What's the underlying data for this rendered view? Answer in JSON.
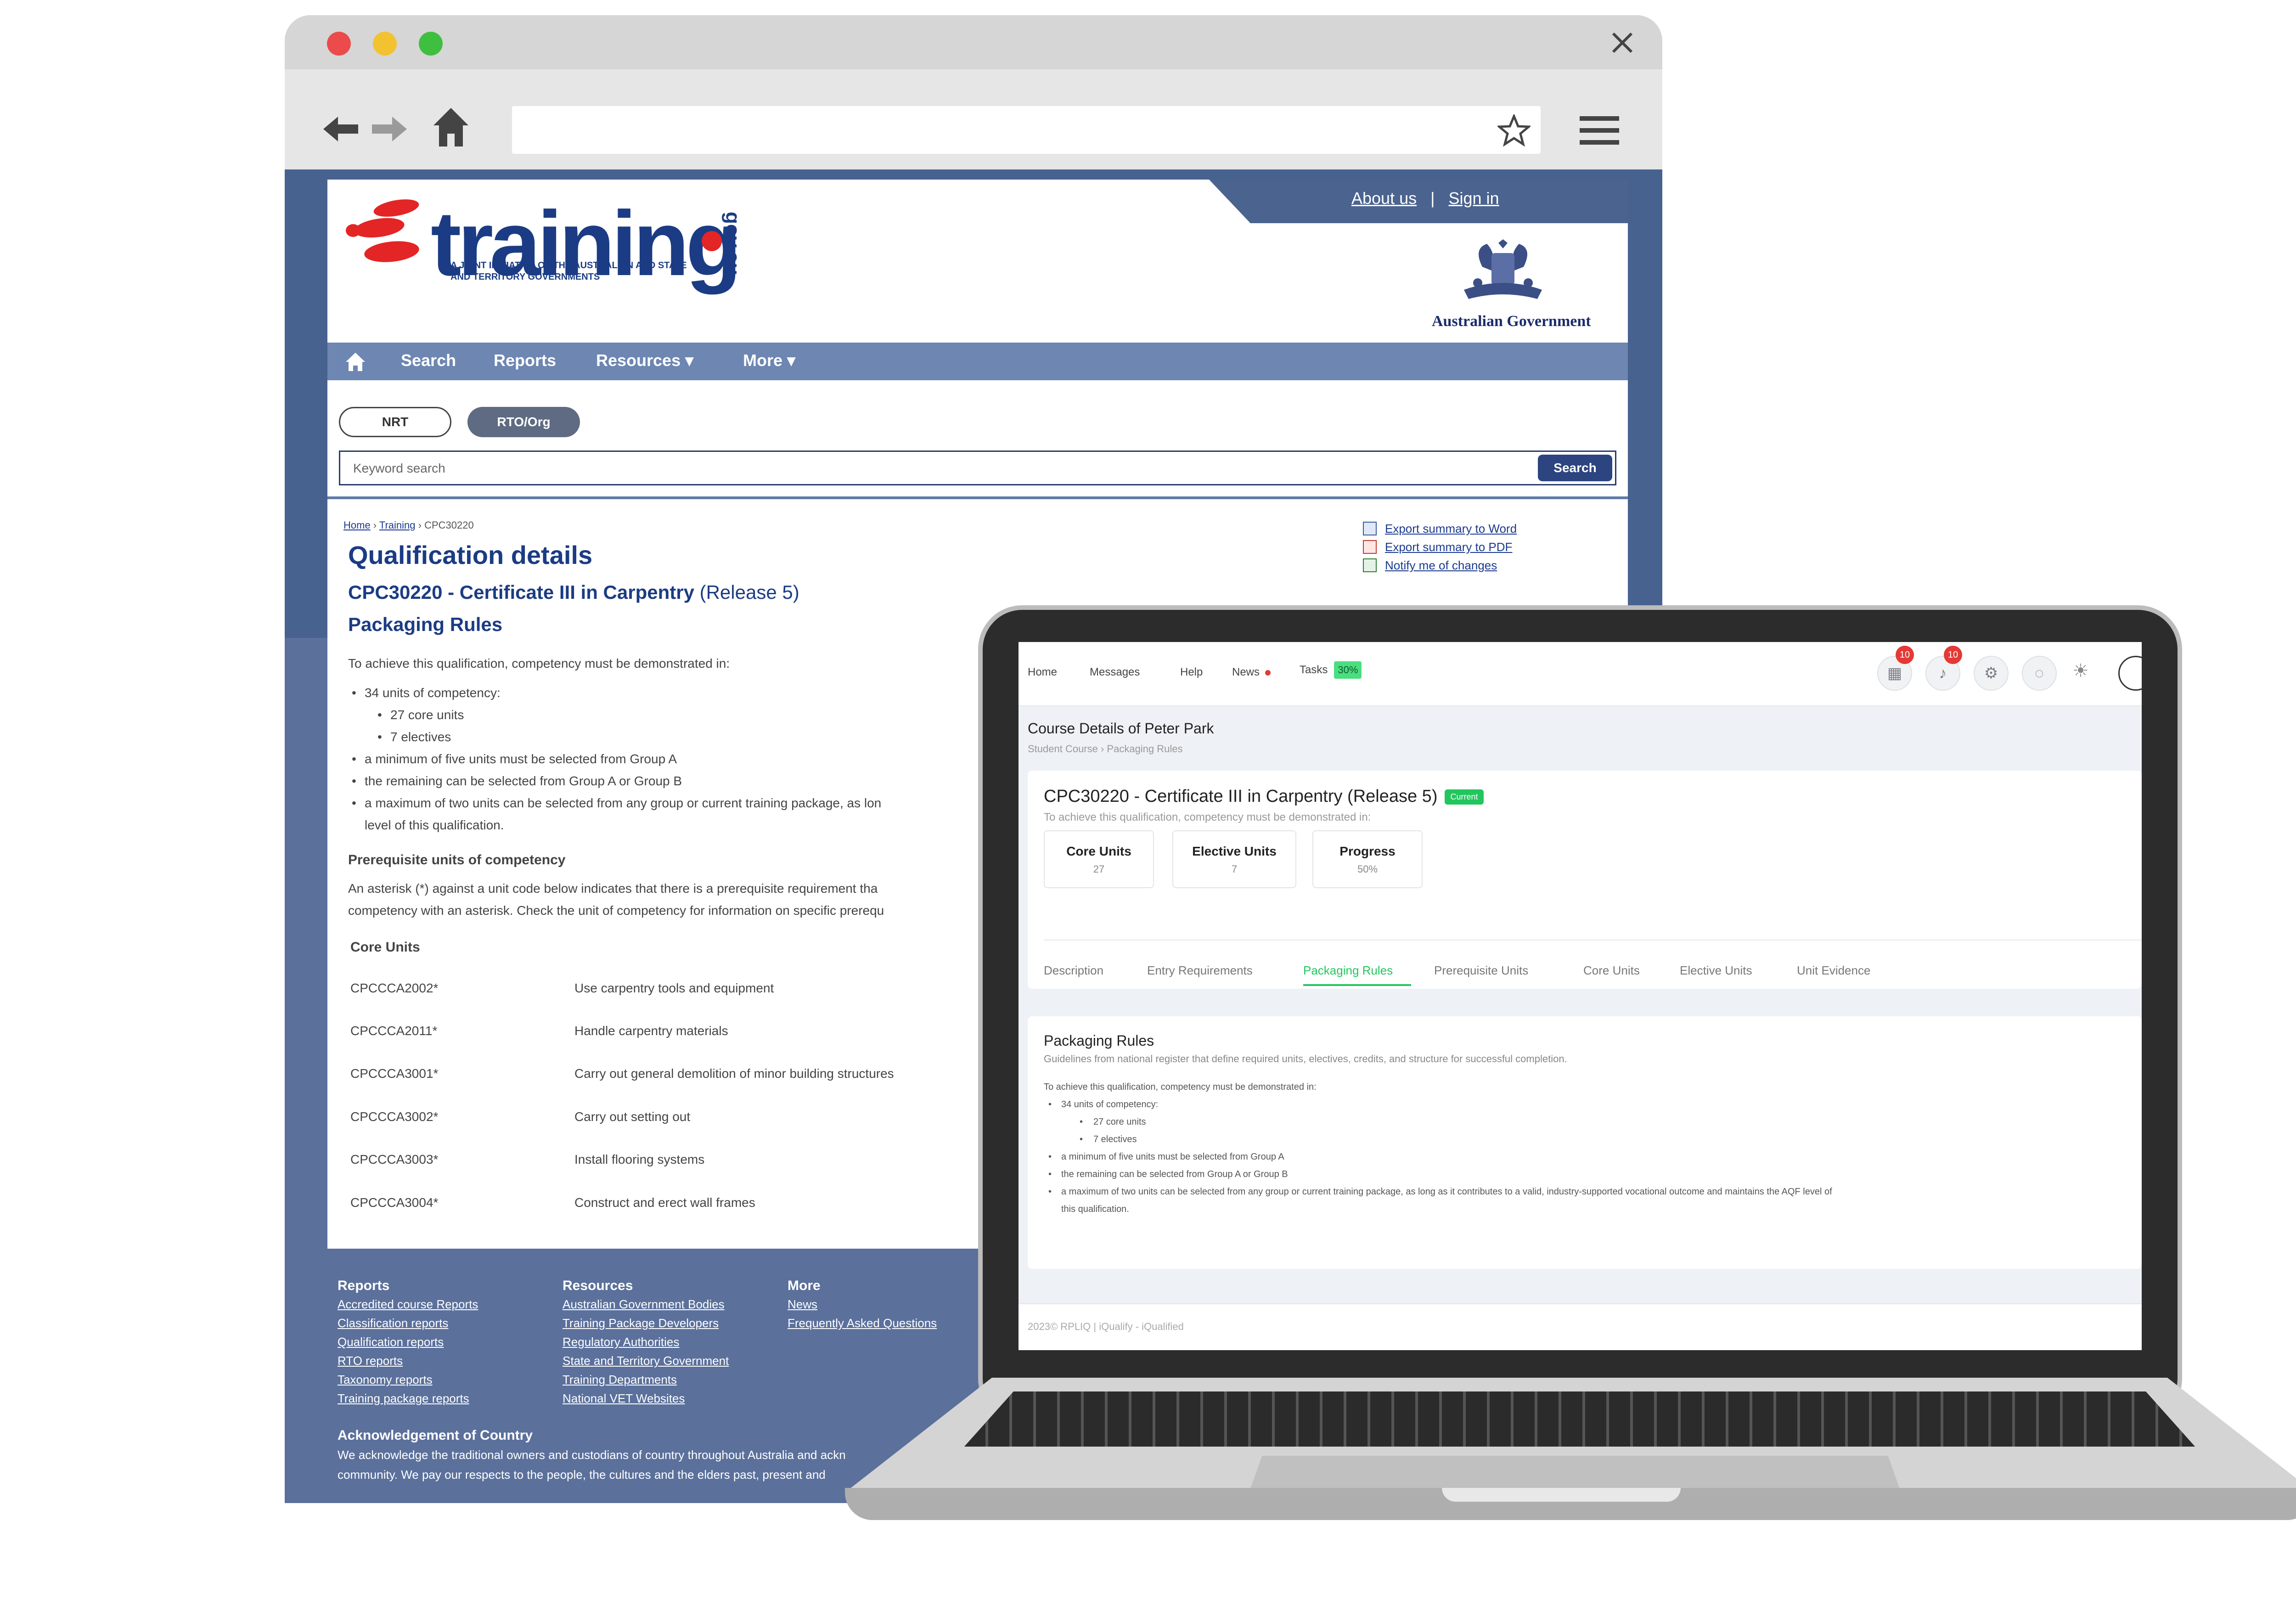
{
  "colors": {
    "brand_navy": "#1b3c84",
    "brand_red": "#e32526",
    "nav_blue": "#6d86b2",
    "footer_blue": "#5b709b",
    "accent_green": "#22c55e"
  },
  "browser": {
    "icons": [
      "close-dot",
      "minimize-dot",
      "maximize-dot",
      "close-icon",
      "back-arrow-icon",
      "forward-arrow-icon",
      "home-icon",
      "star-icon",
      "hamburger-menu-icon"
    ],
    "url": ""
  },
  "site": {
    "logo_word": "training",
    "logo_gov": "gov.au",
    "logo_tag": "A JOINT INITIATIVE OF THE AUSTRALIAN AND STATE AND TERRITORY GOVERNMENTS",
    "about": "About us",
    "sep": "|",
    "signin": "Sign in",
    "aus_gov": "Australian Government",
    "nav": {
      "search": "Search",
      "reports": "Reports",
      "resources": "Resources ▾",
      "more": "More ▾"
    },
    "toggle_nrt": "NRT",
    "toggle_rto": "RTO/Org",
    "search_placeholder": "Keyword search",
    "search_button": "Search",
    "crumb_home": "Home",
    "crumb_training": "Training",
    "crumb_code": "CPC30220",
    "export_word": "Export summary to Word",
    "export_pdf": "Export summary to PDF",
    "notify": "Notify me of changes",
    "heading": "Qualification details",
    "qual_title": "CPC30220 - Certificate III in Carpentry",
    "qual_release": "(Release 5)",
    "packaging_heading": "Packaging Rules",
    "packaging_intro": "To achieve this qualification, competency must be demonstrated in:",
    "rule_units": "34 units of competency:",
    "rule_core": "27 core units",
    "rule_electives": "7 electives",
    "rule_groupA": "a minimum of five units must be selected from Group A",
    "rule_remaining": "the remaining can be selected from Group A or Group B",
    "rule_max_line1": "a maximum of two units can be selected from any group or current training package, as lon",
    "rule_max_line2": "level of this qualification.",
    "prereq_heading": "Prerequisite units of competency",
    "prereq_line1": "An asterisk (*) against a unit code below indicates that there is a prerequisite requirement tha",
    "prereq_line2": "competency with an asterisk. Check the unit of competency for information on specific prerequ",
    "core_heading": "Core Units",
    "units": [
      {
        "code": "CPCCCA2002*",
        "title": "Use carpentry tools and equipment"
      },
      {
        "code": "CPCCCA2011*",
        "title": "Handle carpentry materials"
      },
      {
        "code": "CPCCCA3001*",
        "title": "Carry out general demolition of minor building structures"
      },
      {
        "code": "CPCCCA3002*",
        "title": "Carry out setting out"
      },
      {
        "code": "CPCCCA3003*",
        "title": "Install flooring systems"
      },
      {
        "code": "CPCCCA3004*",
        "title": "Construct and erect wall frames"
      }
    ],
    "footer": {
      "reports_h": "Reports",
      "reports": [
        "Accredited course Reports",
        "Classification reports",
        "Qualification reports",
        "RTO reports",
        "Taxonomy reports",
        "Training package reports"
      ],
      "resources_h": "Resources",
      "resources": [
        "Australian Government Bodies",
        "Training Package Developers",
        "Regulatory Authorities",
        "State and Territory Government",
        "Training Departments",
        "National VET Websites"
      ],
      "more_h": "More",
      "more": [
        "News",
        "Frequently Asked Questions"
      ],
      "ack_h": "Acknowledgement of Country",
      "ack_line1": "We acknowledge the traditional owners and custodians of country throughout Australia and ackn",
      "ack_line2": "community. We pay our respects to the people, the cultures and the elders past, present and"
    }
  },
  "app": {
    "nav": {
      "home": "Home",
      "messages": "Messages",
      "help": "Help",
      "news": "News",
      "tasks": "Tasks",
      "tasks_badge": "30%"
    },
    "badge_a": "10",
    "badge_b": "10",
    "page_title": "Course Details of Peter Park",
    "breadcrumb": "Student Course  ›  Packaging Rules",
    "course_title": "CPC30220 - Certificate III in Carpentry (Release 5)",
    "status": "Current",
    "intro": "To achieve this qualification, competency must be demonstrated in:",
    "stats": [
      {
        "label": "Core Units",
        "value": "27"
      },
      {
        "label": "Elective Units",
        "value": "7"
      },
      {
        "label": "Progress",
        "value": "50%"
      }
    ],
    "tabs": [
      "Description",
      "Entry Requirements",
      "Packaging Rules",
      "Prerequisite Units",
      "Core Units",
      "Elective Units",
      "Unit Evidence"
    ],
    "active_tab": "Packaging Rules",
    "section_h": "Packaging Rules",
    "section_desc": "Guidelines from national register that define required units, electives, credits, and structure for successful completion.",
    "rules_intro": "To achieve this qualification, competency must be demonstrated in:",
    "rule_units": "34 units of competency:",
    "rule_core": "27 core units",
    "rule_electives": "7 electives",
    "rule_groupA": "a minimum of five units must be selected from Group A",
    "rule_remaining": "the remaining can be selected from Group A or Group B",
    "rule_max": "a maximum of two units can be selected from any group or current training package, as long as it contributes to a valid, industry-supported vocational outcome and maintains the AQF level of",
    "rule_max_end": "this qualification.",
    "footer": "2023© RPLIQ | iQualify - iQualified"
  }
}
